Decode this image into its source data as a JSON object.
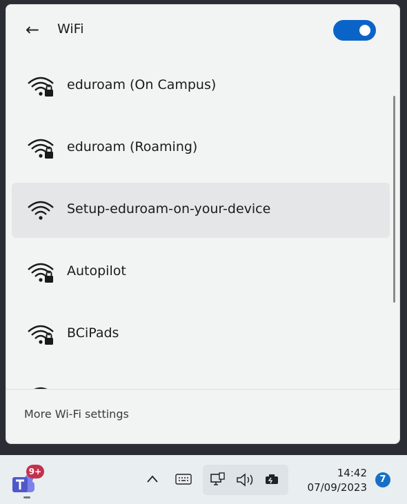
{
  "header": {
    "title": "WiFi",
    "back_icon": "back-arrow-icon",
    "wifi_enabled": true,
    "accent_color": "#0a64c8"
  },
  "networks": [
    {
      "name": "eduroam (On Campus)",
      "secured": true,
      "selected": false
    },
    {
      "name": "eduroam (Roaming)",
      "secured": true,
      "selected": false
    },
    {
      "name": "Setup-eduroam-on-your-device",
      "secured": false,
      "selected": true
    },
    {
      "name": "Autopilot",
      "secured": true,
      "selected": false
    },
    {
      "name": "BCiPads",
      "secured": true,
      "selected": false
    },
    {
      "name": "",
      "secured": false,
      "selected": false
    }
  ],
  "footer": {
    "more_settings_label": "More Wi-Fi settings"
  },
  "taskbar": {
    "teams_badge": "9+",
    "time": "14:42",
    "date": "07/09/2023",
    "notification_count": "7",
    "icons": [
      "teams-icon",
      "chevron-up-icon",
      "keyboard-icon",
      "network-icon",
      "volume-icon",
      "battery-icon"
    ]
  }
}
